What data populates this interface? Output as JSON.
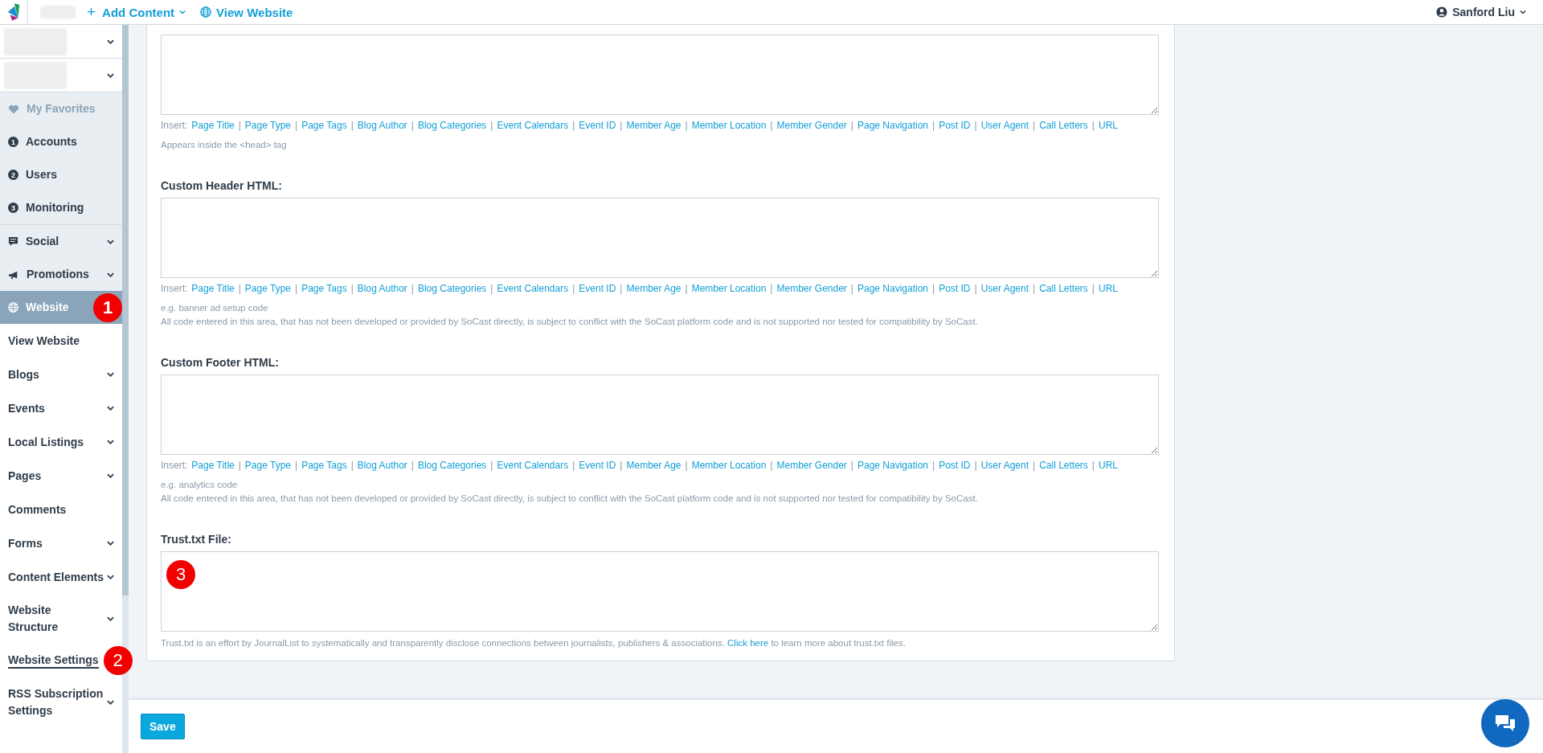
{
  "topbar": {
    "add_content_icon": "+",
    "add_content": "Add Content",
    "view_website": "View Website",
    "user": "Sanford Liu"
  },
  "sidebar": {
    "sections": [
      {
        "kind": "shortcuts",
        "items": [
          {
            "kind": "favorite",
            "label": "My Favorites",
            "selected": false
          },
          {
            "kind": "numbered",
            "number": "1",
            "label": "Accounts",
            "selected": false
          },
          {
            "kind": "numbered",
            "number": "2",
            "label": "Users",
            "selected": false
          },
          {
            "kind": "numbered",
            "number": "3",
            "label": "Monitoring",
            "selected": false
          }
        ]
      },
      {
        "kind": "modules",
        "items": [
          {
            "kind": "social",
            "label": "Social",
            "submenu": true,
            "selected": false
          },
          {
            "kind": "promotions",
            "label": "Promotions",
            "submenu": true,
            "selected": false
          },
          {
            "kind": "website",
            "label": "Website",
            "submenu": false,
            "selected": true,
            "marker": "1"
          }
        ]
      },
      {
        "kind": "pages",
        "items": [
          {
            "label": "View Website",
            "submenu": false,
            "selected": false
          },
          {
            "label": "Blogs",
            "submenu": true,
            "selected": false
          },
          {
            "label": "Events",
            "submenu": true,
            "selected": false
          },
          {
            "label": "Local Listings",
            "submenu": true,
            "selected": false
          },
          {
            "label": "Pages",
            "submenu": true,
            "selected": false
          },
          {
            "label": "Comments",
            "submenu": false,
            "selected": false
          },
          {
            "label": "Forms",
            "submenu": true,
            "selected": false
          },
          {
            "label": "Content Elements",
            "submenu": true,
            "selected": false
          },
          {
            "label": "Website Structure",
            "submenu": true,
            "selected": false
          },
          {
            "label": "Website Settings",
            "submenu": false,
            "selected": true,
            "marker": "2"
          },
          {
            "label": "RSS Subscription Settings",
            "submenu": true,
            "selected": false
          }
        ]
      }
    ]
  },
  "fields": [
    {
      "insert": {
        "prefix": "Insert:",
        "separator": "|",
        "tokens": [
          "Page Title",
          "Page Type",
          "Page Tags",
          "Blog Author",
          "Blog Categories",
          "Event Calendars",
          "Event ID",
          "Member Age",
          "Member Location",
          "Member Gender",
          "Page Navigation",
          "Post ID",
          "User Agent",
          "Call Letters",
          "URL"
        ]
      },
      "notes": [
        "Appears inside the <head> tag"
      ]
    },
    {
      "label": "Custom Header HTML:",
      "insert": {
        "prefix": "Insert:",
        "separator": "|",
        "tokens": [
          "Page Title",
          "Page Type",
          "Page Tags",
          "Blog Author",
          "Blog Categories",
          "Event Calendars",
          "Event ID",
          "Member Age",
          "Member Location",
          "Member Gender",
          "Page Navigation",
          "Post ID",
          "User Agent",
          "Call Letters",
          "URL"
        ]
      },
      "notes": [
        "e.g. banner ad setup code",
        "All code entered in this area, that has not been developed or provided by SoCast directly, is subject to conflict with the SoCast platform code and is not supported nor tested for compatibility by SoCast."
      ]
    },
    {
      "label": "Custom Footer HTML:",
      "insert": {
        "prefix": "Insert:",
        "separator": "|",
        "tokens": [
          "Page Title",
          "Page Type",
          "Page Tags",
          "Blog Author",
          "Blog Categories",
          "Event Calendars",
          "Event ID",
          "Member Age",
          "Member Location",
          "Member Gender",
          "Page Navigation",
          "Post ID",
          "User Agent",
          "Call Letters",
          "URL"
        ]
      },
      "notes": [
        "e.g. analytics code",
        "All code entered in this area, that has not been developed or provided by SoCast directly, is subject to conflict with the SoCast platform code and is not supported nor tested for compatibility by SoCast."
      ]
    },
    {
      "label": "Trust.txt File:",
      "marker": "3",
      "help": {
        "before": "Trust.txt is an effort by JournalList to systematically and transparently disclose connections between journalists, publishers & associations.",
        "link": "Click here",
        "after": "to learn more about trust.txt files."
      }
    }
  ],
  "footer": {
    "save": "Save"
  }
}
